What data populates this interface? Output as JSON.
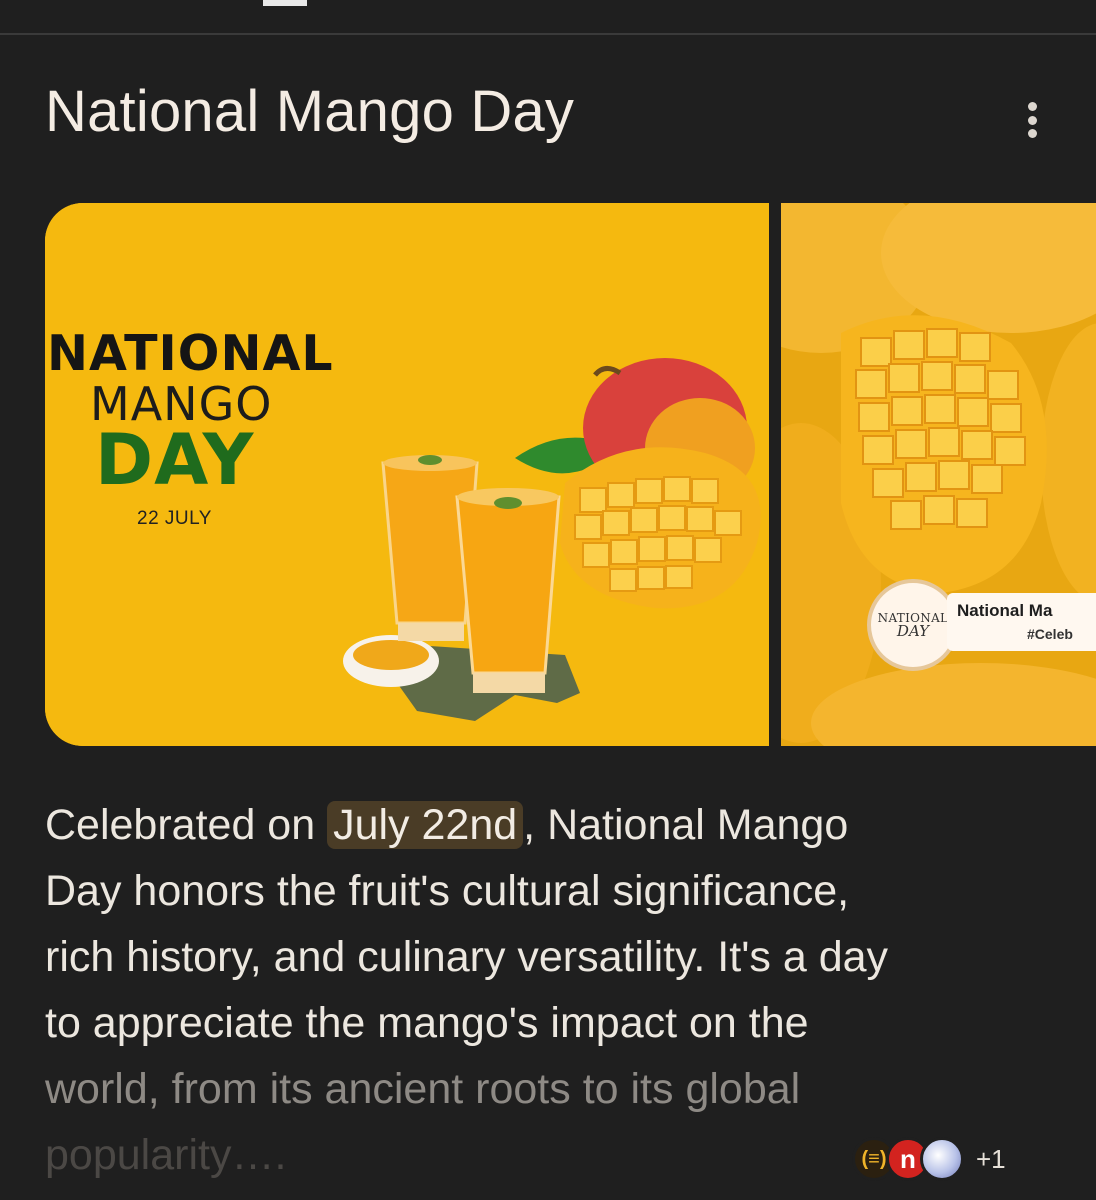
{
  "header": {
    "title": "National Mango Day",
    "more_icon": "more-vert-icon"
  },
  "images": [
    {
      "poster_line1": "NATIONAL",
      "poster_line2": "MANGO",
      "poster_line3": "DAY",
      "poster_date": "22 JULY",
      "colors": {
        "background": "#f5b90f",
        "mango_green": "#1f6b1d"
      }
    },
    {
      "badge_line1": "NATIONAL",
      "badge_line2": "DAY",
      "caption_line1": "National Ma",
      "caption_line2": "#Celeb"
    }
  ],
  "description": {
    "pre": "Celebrated on ",
    "highlight": "July 22nd",
    "line1_post": ", National Mango",
    "line2": "Day honors the fruit's cultural significance,",
    "line3": "rich history, and culinary versatility. It's a day",
    "line4": "to appreciate the mango's impact on the",
    "line5": "world, from its ancient roots to its global",
    "line6": "popularity…."
  },
  "sources": {
    "icons": [
      "source-logo-icon",
      "n-logo-icon",
      "globe-icon"
    ],
    "extra_count": "+1"
  },
  "colors": {
    "page_bg": "#1f1f1f",
    "highlight_bg": "#4a3c26",
    "text": "#ece7df"
  }
}
